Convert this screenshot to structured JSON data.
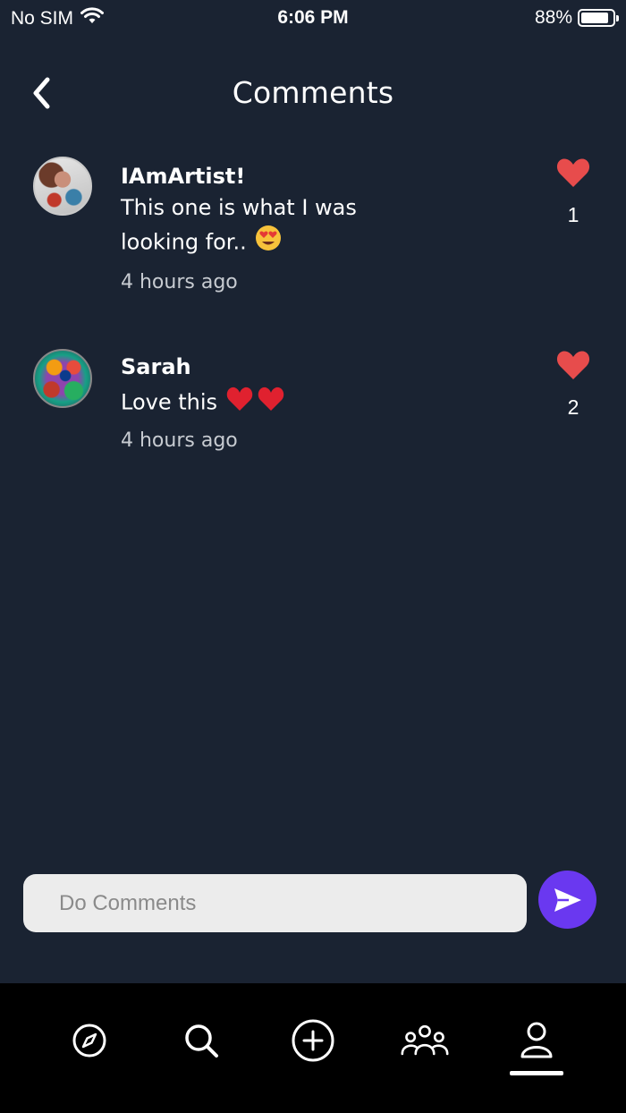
{
  "status_bar": {
    "carrier": "No SIM",
    "time": "6:06 PM",
    "battery_percent": "88%",
    "battery_level": 0.88
  },
  "header": {
    "title": "Comments",
    "back_icon": "chevron-left-icon"
  },
  "comments": [
    {
      "author": "IAmArtist!",
      "text_line1": "This one is what I was",
      "text_line2": "looking for..",
      "emoji": "😍",
      "time": "4 hours ago",
      "likes": "1"
    },
    {
      "author": "Sarah",
      "text": "Love this",
      "emoji": "❤️❤️",
      "time": "4 hours ago",
      "likes": "2"
    }
  ],
  "composer": {
    "placeholder": "Do Comments",
    "send_icon": "send-icon"
  },
  "bottom_nav": {
    "items": [
      "explore-icon",
      "search-icon",
      "add-icon",
      "community-icon",
      "profile-icon"
    ],
    "active": "profile-icon"
  },
  "colors": {
    "background": "#1a2332",
    "like_red": "#e74c4c",
    "accent_purple": "#6a38f0",
    "nav_bg": "#000000"
  }
}
